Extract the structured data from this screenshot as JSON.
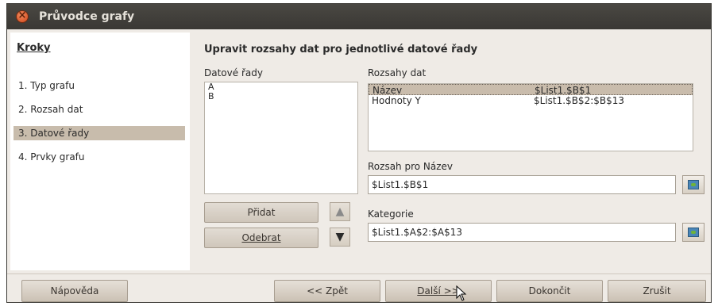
{
  "window": {
    "title": "Průvodce grafy"
  },
  "sidebar": {
    "heading": "Kroky",
    "steps": [
      {
        "label": "1. Typ grafu",
        "active": false
      },
      {
        "label": "2. Rozsah dat",
        "active": false
      },
      {
        "label": "3. Datové řady",
        "active": true
      },
      {
        "label": "4. Prvky grafu",
        "active": false
      }
    ]
  },
  "main": {
    "heading": "Upravit rozsahy dat pro jednotlivé datové řady",
    "series_label": "Datové řady",
    "series": [
      "A",
      "B"
    ],
    "ranges_label": "Rozsahy dat",
    "ranges": [
      {
        "name": "Název",
        "value": "$List1.$B$1",
        "selected": true
      },
      {
        "name": "Hodnoty Y",
        "value": "$List1.$B$2:$B$13",
        "selected": false
      }
    ],
    "add_button": "Přidat",
    "remove_button": "Odebrat",
    "name_range_label": "Rozsah pro Název",
    "name_range_value": "$List1.$B$1",
    "categories_label": "Kategorie",
    "categories_value": "$List1.$A$2:$A$13"
  },
  "footer": {
    "help": "Nápověda",
    "back": "<< Zpět",
    "next": "Další >>",
    "finish": "Dokončit",
    "cancel": "Zrušit"
  }
}
